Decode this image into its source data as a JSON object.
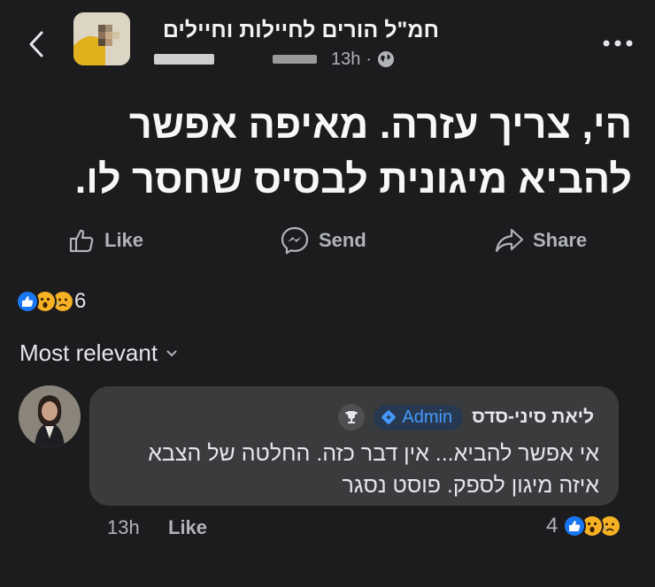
{
  "header": {
    "group_name": "חמ\"ל הורים לחיילות וחיילים",
    "time": "13h",
    "separator": "·",
    "visibility_icon": "globe-icon",
    "back_icon": "chevron-left-icon",
    "more_icon": "more-dots-icon"
  },
  "post": {
    "text": "הי, צריך עזרה. מאיפה אפשר להביא מיגונית לבסיס שחסר לו."
  },
  "actions": {
    "like_label": "Like",
    "send_label": "Send",
    "share_label": "Share"
  },
  "reactions": {
    "types": [
      "like",
      "wow",
      "sad"
    ],
    "count": "6"
  },
  "comments_sort": {
    "label": "Most relevant"
  },
  "comment": {
    "author": "ליאת סיני-סדס",
    "badge_label": "Admin",
    "text": "אי אפשר להביא... אין דבר כזה. החלטה של הצבא איזה מיגון לספק. פוסט נסגר",
    "time": "13h",
    "like_label": "Like",
    "reaction_count": "4"
  },
  "colors": {
    "background": "#1c1c1e",
    "bubble": "#3a3b3c",
    "accent_blue": "#1877f2",
    "badge_text": "#4599ff"
  }
}
